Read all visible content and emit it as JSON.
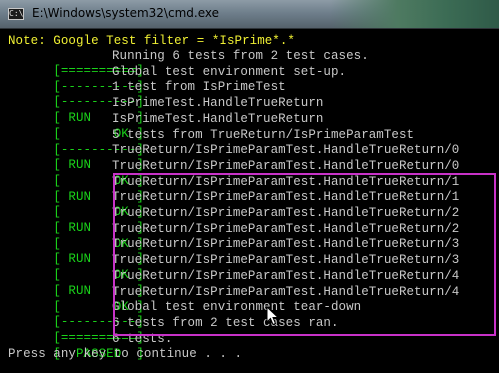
{
  "window": {
    "title": "E:\\Windows\\system32\\cmd.exe",
    "icon": "cmd-window-icon",
    "icon_glyph": "C:\\"
  },
  "colors": {
    "background": "#000000",
    "green": "#1ad21a",
    "yellow": "#f0f033",
    "gray": "#c8c8c8",
    "highlight": "#c832c8"
  },
  "console": {
    "filter_note": "Note: Google Test filter = *IsPrime*.*",
    "lines": [
      {
        "tag": "[==========]",
        "text": "Running 6 tests from 2 test cases."
      },
      {
        "tag": "[----------]",
        "text": "Global test environment set-up."
      },
      {
        "tag": "[----------]",
        "text": "1 test from IsPrimeTest"
      },
      {
        "tag": "[ RUN      ]",
        "text": "IsPrimeTest.HandleTrueReturn"
      },
      {
        "tag": "[       OK ]",
        "text": "IsPrimeTest.HandleTrueReturn"
      },
      {
        "tag": "[----------]",
        "text": "5 tests from TrueReturn/IsPrimeParamTest"
      },
      {
        "tag": "[ RUN      ]",
        "text": "TrueReturn/IsPrimeParamTest.HandleTrueReturn/0"
      },
      {
        "tag": "[       OK ]",
        "text": "TrueReturn/IsPrimeParamTest.HandleTrueReturn/0"
      },
      {
        "tag": "[ RUN      ]",
        "text": "TrueReturn/IsPrimeParamTest.HandleTrueReturn/1"
      },
      {
        "tag": "[       OK ]",
        "text": "TrueReturn/IsPrimeParamTest.HandleTrueReturn/1"
      },
      {
        "tag": "[ RUN      ]",
        "text": "TrueReturn/IsPrimeParamTest.HandleTrueReturn/2"
      },
      {
        "tag": "[       OK ]",
        "text": "TrueReturn/IsPrimeParamTest.HandleTrueReturn/2"
      },
      {
        "tag": "[ RUN      ]",
        "text": "TrueReturn/IsPrimeParamTest.HandleTrueReturn/3"
      },
      {
        "tag": "[       OK ]",
        "text": "TrueReturn/IsPrimeParamTest.HandleTrueReturn/3"
      },
      {
        "tag": "[ RUN      ]",
        "text": "TrueReturn/IsPrimeParamTest.HandleTrueReturn/4"
      },
      {
        "tag": "[       OK ]",
        "text": "TrueReturn/IsPrimeParamTest.HandleTrueReturn/4"
      },
      {
        "tag": "[----------]",
        "text": "Global test environment tear-down"
      },
      {
        "tag": "[==========]",
        "text": "6 tests from 2 test cases ran."
      },
      {
        "tag": "[  PASSED  ]",
        "text": "6 tests."
      }
    ],
    "prompt": "Press any key to continue . . ."
  }
}
